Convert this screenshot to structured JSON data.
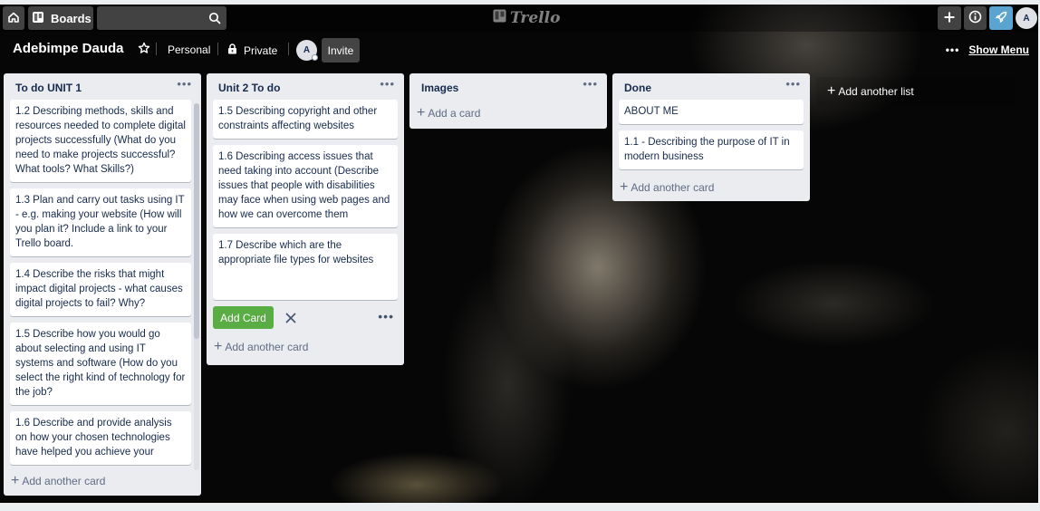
{
  "header": {
    "boards_label": "Boards",
    "search": {
      "value": "",
      "placeholder": ""
    },
    "logo_text": "Trello",
    "avatar_initial": "A",
    "icons": [
      "home-icon",
      "boards-icon",
      "search-icon",
      "plus-icon",
      "info-icon",
      "rocket-icon"
    ]
  },
  "board": {
    "title": "Adebimpe Dauda",
    "team_label": "Personal",
    "visibility_label": "Private",
    "member_initial": "A",
    "invite_label": "Invite",
    "show_menu_label": "Show Menu",
    "starred": false
  },
  "lists": [
    {
      "title": "To do UNIT 1",
      "cards": [
        "1.2 Describing methods, skills and resources needed to complete digital projects successfully (What do you need to make projects successful? What tools? What Skills?)",
        "1.3 Plan and carry out tasks using IT - e.g. making your website (How will you plan it? Include a link to your Trello board.",
        "1.4 Describe the risks that might impact digital projects - what causes digital projects to fail? Why?",
        "1.5 Describe how you would go about selecting and using IT systems and software (How do you select the right kind of technology for the job?",
        "1.6 Describe and provide analysis on how your chosen technologies have helped you achieve your"
      ],
      "add_label": "Add another card"
    },
    {
      "title": "Unit 2 To do",
      "cards": [
        "1.5 Describing copyright and other constraints affecting websites",
        "1.6 Describing access issues that need taking into account (Describe issues that people with disabilities may face when using web pages and how we can overcome them",
        "1.7 Describe which are the appropriate file types for websites"
      ],
      "composer": {
        "value": "",
        "add_button_label": "Add Card"
      },
      "add_label": "Add another card"
    },
    {
      "title": "Images",
      "cards": [],
      "add_label": "Add a card"
    },
    {
      "title": "Done",
      "cards": [
        "ABOUT ME",
        "1.1 - Describing the purpose of IT in modern business"
      ],
      "add_label": "Add another card"
    }
  ],
  "add_list_label": "Add another list",
  "colors": {
    "header_overlay": "rgba(0,0,0,0.35)",
    "list_bg": "#ebecf0",
    "add_card_button": "#5aac44",
    "rocket_button": "#5ba4cf",
    "text": "#172b4d"
  }
}
